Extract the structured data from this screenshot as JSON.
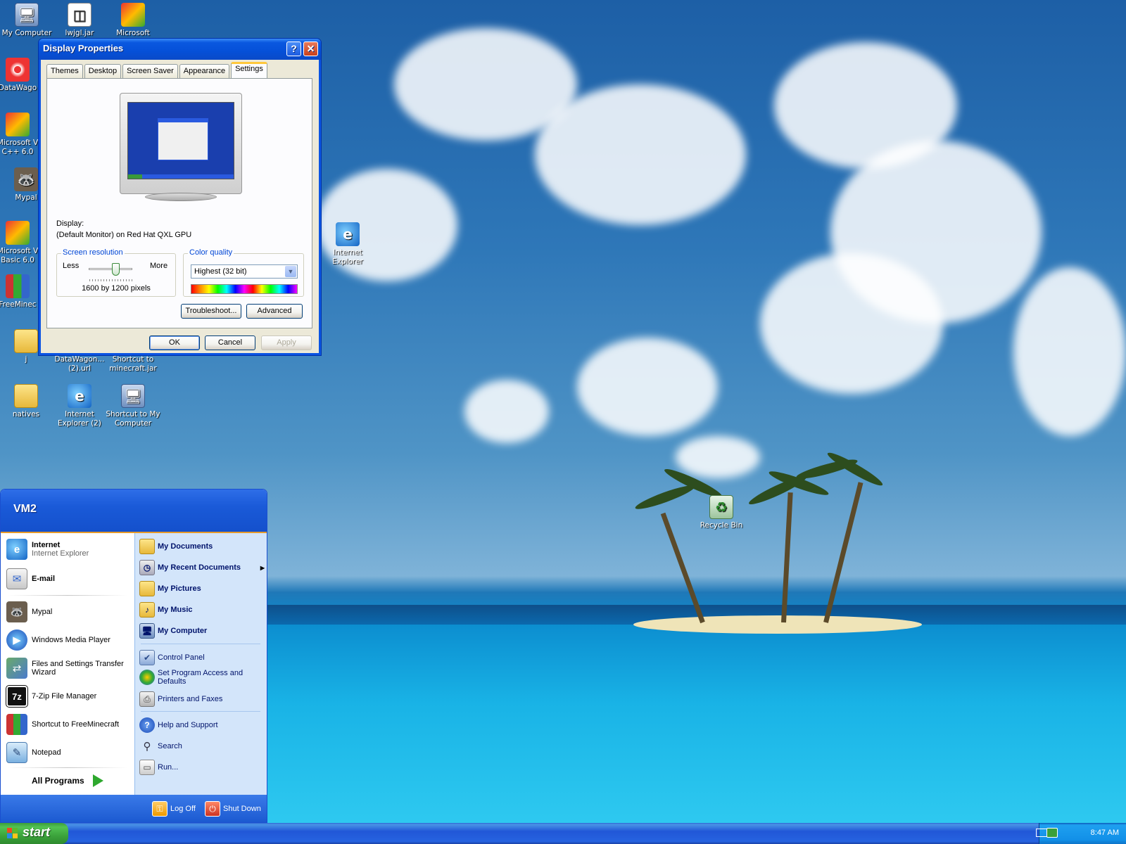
{
  "desktop_icons": [
    {
      "label": "My Computer",
      "icon": "my-computer-icon"
    },
    {
      "label": "lwjgl.jar",
      "icon": "jar-file-icon"
    },
    {
      "label": "Microsoft Visual",
      "icon": "visual-studio-icon"
    },
    {
      "label": "DataWago",
      "icon": "datawagon-icon"
    },
    {
      "label": "Microsoft V C++ 6.0",
      "icon": "visual-cpp-icon"
    },
    {
      "label": "Mypal",
      "icon": "mypal-icon"
    },
    {
      "label": "Microsoft V Basic 6.0",
      "icon": "visual-basic-icon"
    },
    {
      "label": "FreeMinec",
      "icon": "freeminecraft-icon"
    },
    {
      "label": "j",
      "icon": "folder-icon"
    },
    {
      "label": "DataWagon... (2).url",
      "icon": "url-file-icon"
    },
    {
      "label": "Shortcut to minecraft.jar",
      "icon": "jar-shortcut-icon"
    },
    {
      "label": "natives",
      "icon": "folder-icon"
    },
    {
      "label": "Internet Explorer (2)",
      "icon": "internet-explorer-icon"
    },
    {
      "label": "Shortcut to My Computer",
      "icon": "my-computer-shortcut-icon"
    },
    {
      "label": "Internet Explorer",
      "icon": "internet-explorer-icon"
    },
    {
      "label": "Recycle Bin",
      "icon": "recycle-bin-icon"
    }
  ],
  "dialog": {
    "title": "Display Properties",
    "help_symbol": "?",
    "close_symbol": "✕",
    "tabs": [
      "Themes",
      "Desktop",
      "Screen Saver",
      "Appearance",
      "Settings"
    ],
    "active_tab": "Settings",
    "display_label": "Display:",
    "display_value": "(Default Monitor) on Red Hat QXL GPU",
    "resolution": {
      "title": "Screen resolution",
      "less": "Less",
      "more": "More",
      "value": "1600 by 1200 pixels"
    },
    "color_quality": {
      "title": "Color quality",
      "selected": "Highest (32 bit)"
    },
    "troubleshoot_label": "Troubleshoot...",
    "advanced_label": "Advanced",
    "ok_label": "OK",
    "cancel_label": "Cancel",
    "apply_label": "Apply"
  },
  "start_menu": {
    "user": "VM2",
    "pinned": [
      {
        "title": "Internet",
        "subtitle": "Internet Explorer",
        "icon": "internet-explorer-icon"
      },
      {
        "title": "E-mail",
        "subtitle": "",
        "icon": "email-icon"
      }
    ],
    "recent": [
      {
        "label": "Mypal",
        "icon": "mypal-icon"
      },
      {
        "label": "Windows Media Player",
        "icon": "media-player-icon"
      },
      {
        "label": "Files and Settings Transfer Wizard",
        "icon": "transfer-wizard-icon"
      },
      {
        "label": "7-Zip File Manager",
        "icon": "7zip-icon"
      },
      {
        "label": "Shortcut to FreeMinecraft",
        "icon": "freeminecraft-icon"
      },
      {
        "label": "Notepad",
        "icon": "notepad-icon"
      }
    ],
    "all_programs": "All Programs",
    "right_items": [
      {
        "label": "My Documents",
        "bold": true,
        "icon": "documents-icon"
      },
      {
        "label": "My Recent Documents",
        "bold": true,
        "icon": "recent-documents-icon",
        "submenu": true
      },
      {
        "label": "My Pictures",
        "bold": true,
        "icon": "pictures-icon"
      },
      {
        "label": "My Music",
        "bold": true,
        "icon": "music-icon"
      },
      {
        "label": "My Computer",
        "bold": true,
        "icon": "my-computer-icon"
      },
      {
        "label": "Control Panel",
        "bold": false,
        "icon": "control-panel-icon"
      },
      {
        "label": "Set Program Access and Defaults",
        "bold": false,
        "icon": "program-defaults-icon"
      },
      {
        "label": "Printers and Faxes",
        "bold": false,
        "icon": "printer-icon"
      },
      {
        "label": "Help and Support",
        "bold": false,
        "icon": "help-icon"
      },
      {
        "label": "Search",
        "bold": false,
        "icon": "search-icon"
      },
      {
        "label": "Run...",
        "bold": false,
        "icon": "run-icon"
      }
    ],
    "log_off": "Log Off",
    "shut_down": "Shut Down"
  },
  "taskbar": {
    "start_label": "start",
    "clock": "8:47 AM"
  }
}
